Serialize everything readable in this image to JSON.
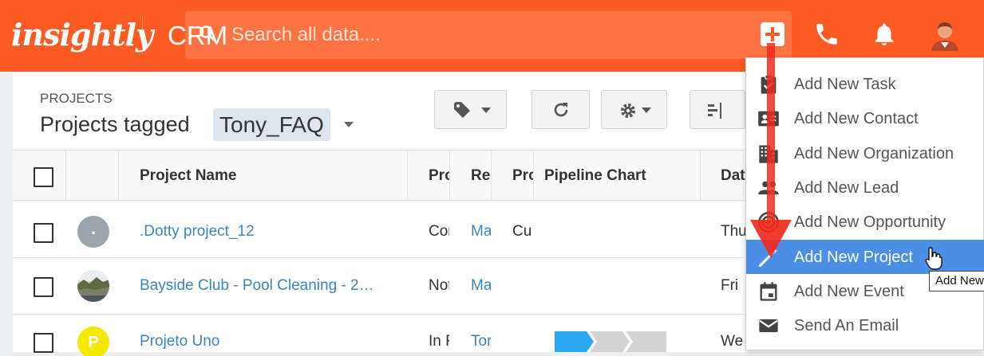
{
  "header": {
    "logo": "insightly",
    "app": "CRM",
    "search_placeholder": "Search all data...."
  },
  "page": {
    "breadcrumb": "PROJECTS",
    "title": "Projects tagged",
    "tag": "Tony_FAQ"
  },
  "table": {
    "columns": [
      "Project Name",
      "Pro",
      "Re",
      "Pro",
      "Pipeline Chart",
      "Dat"
    ],
    "rows": [
      {
        "name": ".Dotty project_12",
        "c1": "Cor",
        "c2": "Ma",
        "c3": "Cu",
        "date": "Thu",
        "avatar": "."
      },
      {
        "name": "Bayside Club - Pool Cleaning - 2…",
        "c1": "Not",
        "c2": "Ma",
        "c3": "",
        "date": "Fri",
        "avatar": ""
      },
      {
        "name": "Projeto Uno",
        "c1": "In F",
        "c2": "Tor",
        "c3": "",
        "date": "We",
        "avatar": "P"
      }
    ]
  },
  "menu": {
    "items": [
      {
        "label": "Add New Task",
        "icon": "clipboard-check-icon"
      },
      {
        "label": "Add New Contact",
        "icon": "contact-card-icon"
      },
      {
        "label": "Add New Organization",
        "icon": "building-icon"
      },
      {
        "label": "Add New Lead",
        "icon": "people-icon"
      },
      {
        "label": "Add New Opportunity",
        "icon": "target-icon"
      },
      {
        "label": "Add New Project",
        "icon": "wand-icon"
      },
      {
        "label": "Add New Event",
        "icon": "calendar-icon"
      },
      {
        "label": "Send An Email",
        "icon": "envelope-icon"
      }
    ],
    "highlighted_index": 5,
    "tooltip": "Add New"
  },
  "colors": {
    "brand": "#fd5b24",
    "link": "#3b84bd",
    "highlight": "#4a8ee5",
    "annotation_arrow": "#f02a1c"
  }
}
